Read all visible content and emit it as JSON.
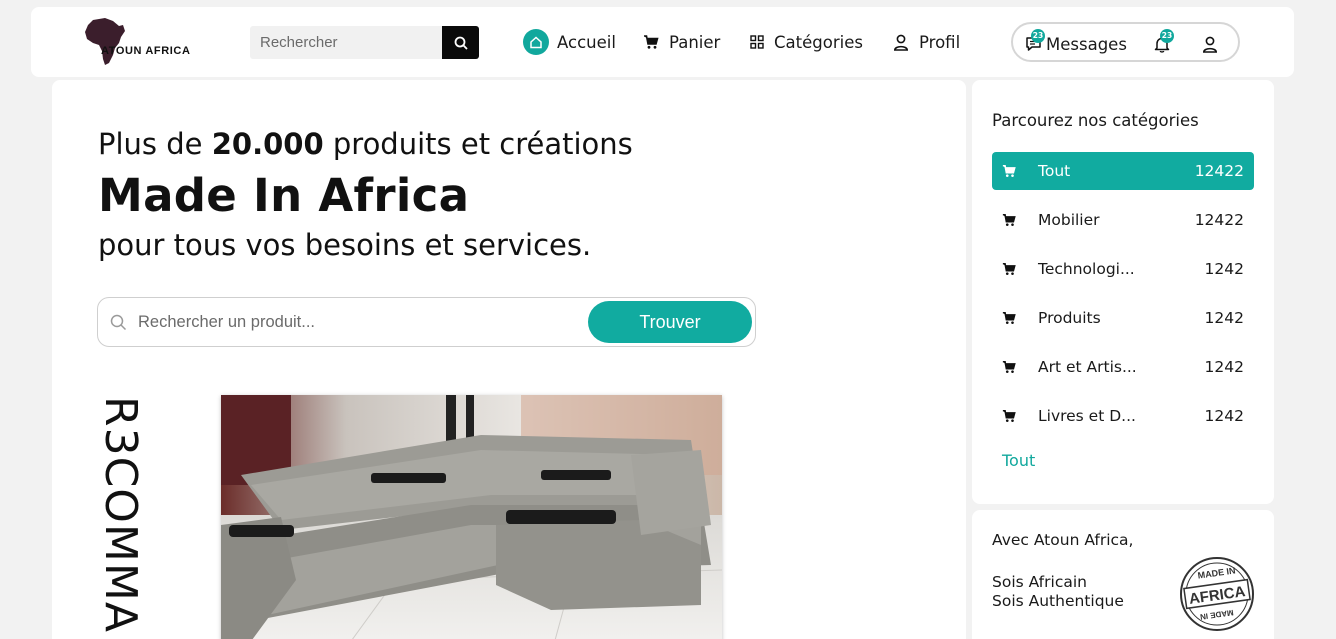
{
  "header": {
    "logo_text": "ATOUN AFRICA",
    "search_placeholder": "Rechercher",
    "nav": {
      "home": "Accueil",
      "cart": "Panier",
      "categories": "Catégories",
      "profile": "Profil",
      "messages": "Messages"
    },
    "messages_badge": "23",
    "notifications_badge": "23"
  },
  "hero": {
    "line1_prefix": "Plus de ",
    "line1_bold": "20.000",
    "line1_suffix": " produits et créations",
    "line2": "Made In Africa",
    "line3": "pour tous vos besoins et services.",
    "search_placeholder": "Rechercher un produit...",
    "search_button": "Trouver"
  },
  "recommend_label": "R3COMMA",
  "categories": {
    "title": "Parcourez nos catégories",
    "items": [
      {
        "name": "Tout",
        "count": "12422",
        "active": true
      },
      {
        "name": "Mobilier",
        "count": "12422"
      },
      {
        "name": "Technologi...",
        "count": "1242"
      },
      {
        "name": "Produits",
        "count": "1242"
      },
      {
        "name": "Art et Artis...",
        "count": "1242"
      },
      {
        "name": "Livres et D...",
        "count": "1242"
      }
    ],
    "all_link": "Tout"
  },
  "promo": {
    "line1": "Avec Atoun Africa,",
    "line2": "Sois Africain",
    "line3": "Sois Authentique",
    "stamp_text_top": "MADE IN",
    "stamp_text_mid": "AFRICA",
    "stamp_text_bottom": "MADE IN"
  },
  "colors": {
    "accent": "#11aba0",
    "text": "#1a1a1a",
    "background": "#f2f2f2"
  }
}
